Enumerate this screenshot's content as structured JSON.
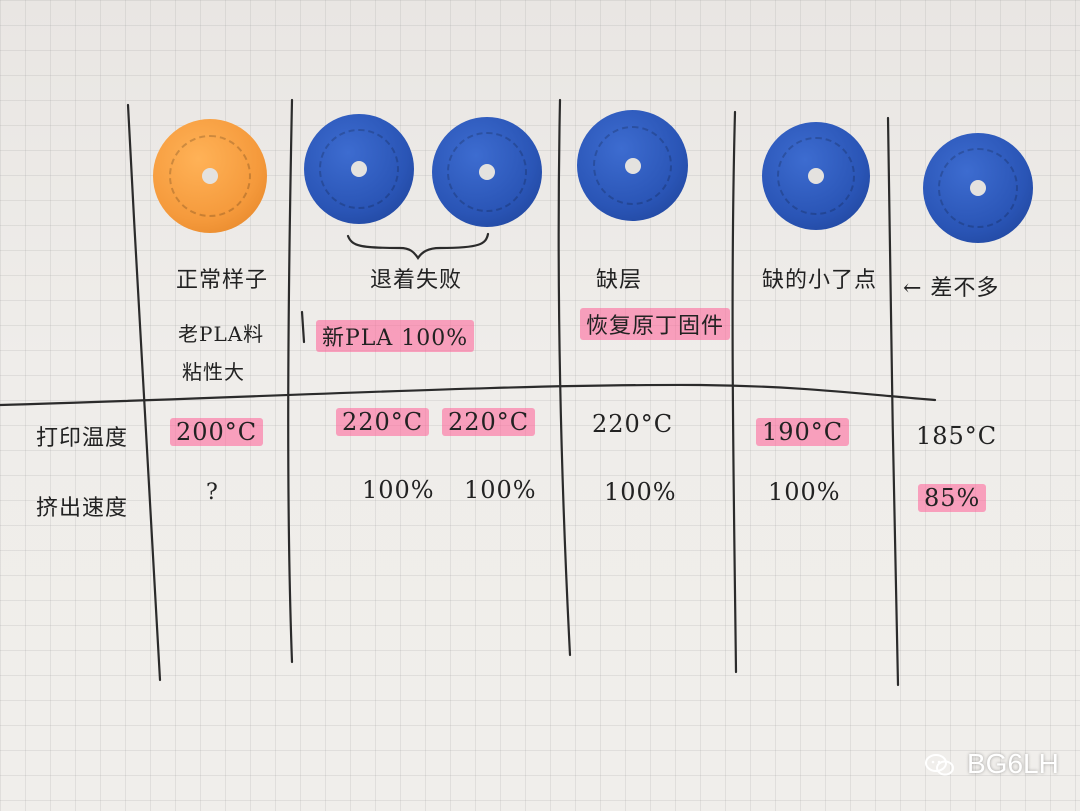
{
  "colors": {
    "orange": "#f59a3c",
    "blue": "#2a55b6",
    "highlight": "#ff5f96",
    "ink": "#222222",
    "paper": "#eeece9"
  },
  "samples": [
    {
      "label": "正常样子",
      "note1": "老PLA料",
      "note2": "粘性大",
      "temp": "200°C",
      "speed": "?"
    },
    {
      "label": "退着失败",
      "note1": "新PLA 100%",
      "temp_a": "220°C",
      "temp_b": "220°C",
      "speed_a": "100%",
      "speed_b": "100%"
    },
    {
      "label": "缺层",
      "note1": "恢复原丁固件",
      "temp": "220°C",
      "speed": "100%"
    },
    {
      "label": "缺的小了点",
      "temp": "190°C",
      "speed": "100%"
    },
    {
      "label": "← 差不多",
      "temp": "185°C",
      "speed": "85%"
    }
  ],
  "row_labels": {
    "temp": "打印温度",
    "speed": "挤出速度"
  },
  "watermark": {
    "icon": "wechat-icon",
    "text": "BG6LH"
  }
}
